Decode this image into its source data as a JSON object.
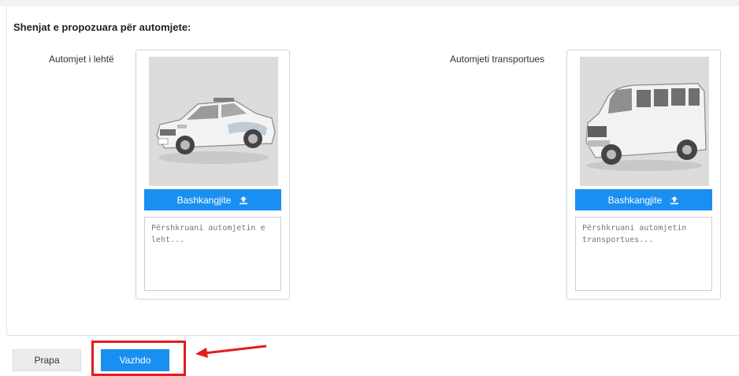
{
  "page": {
    "section_title": "Shenjat e propozuara për automjete:"
  },
  "vehicles": [
    {
      "label": "Automjet i lehtë",
      "image": "sedan-car-photo",
      "attach_label": "Bashkangjite",
      "attach_icon": "upload-icon",
      "description_placeholder": "Përshkruani automjetin e leht...",
      "description_value": ""
    },
    {
      "label": "Automjeti transportues",
      "image": "van-photo",
      "attach_label": "Bashkangjite",
      "attach_icon": "upload-icon",
      "description_placeholder": "Përshkruani automjetin transportues...",
      "description_value": ""
    }
  ],
  "footer": {
    "back_label": "Prapa",
    "next_label": "Vazhdo"
  },
  "annotation": {
    "highlight_color": "#e01e1e",
    "arrow_color": "#e01e1e",
    "target": "next-button"
  },
  "colors": {
    "primary": "#1a8ff2",
    "photo_bg": "#dcdcdc",
    "border": "#d4d4d4"
  }
}
